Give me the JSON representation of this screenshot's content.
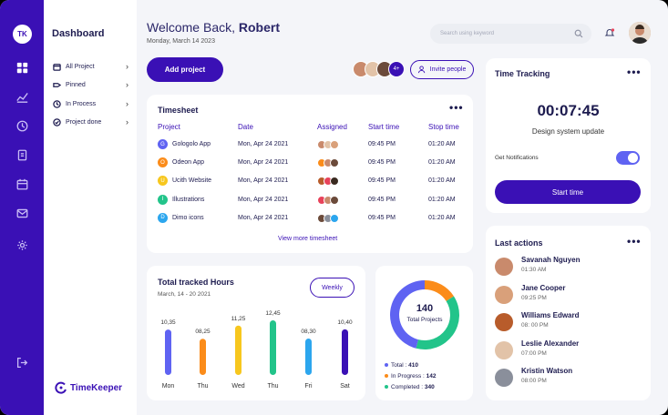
{
  "rail": {
    "logo": "TK"
  },
  "sidebar": {
    "title": "Dashboard",
    "items": [
      {
        "label": "All Project"
      },
      {
        "label": "Pinned"
      },
      {
        "label": "In Process"
      },
      {
        "label": "Project done"
      }
    ],
    "brand": "TimeKeeper"
  },
  "header": {
    "welcome_prefix": "Welcome Back, ",
    "user": "Robert",
    "date": "Monday, March 14 2023",
    "search_placeholder": "Search using keyword"
  },
  "actions": {
    "add_project": "Add project",
    "more_count": "4+",
    "invite": "Invite people"
  },
  "timesheet": {
    "title": "Timesheet",
    "columns": [
      "Project",
      "Date",
      "Assigned",
      "Start time",
      "Stop time"
    ],
    "rows": [
      {
        "icon": "G",
        "color": "#5f63f2",
        "project": "Gologolo App",
        "date": "Mon, Apr 24 2021",
        "start": "09:45 PM",
        "stop": "01:20 AM"
      },
      {
        "icon": "O",
        "color": "#fb8c1a",
        "project": "Odeon App",
        "date": "Mon, Apr 24 2021",
        "start": "09:45 PM",
        "stop": "01:20 AM"
      },
      {
        "icon": "U",
        "color": "#f7c71e",
        "project": "Ucith Website",
        "date": "Mon, Apr 24 2021",
        "start": "09:45 PM",
        "stop": "01:20 AM"
      },
      {
        "icon": "I",
        "color": "#22c48a",
        "project": "Illustrations",
        "date": "Mon, Apr 24 2021",
        "start": "09:45 PM",
        "stop": "01:20 AM"
      },
      {
        "icon": "D",
        "color": "#2ca6ee",
        "project": "Dimo icons",
        "date": "Mon, Apr 24 2021",
        "start": "09:45 PM",
        "stop": "01:20 AM"
      }
    ],
    "view_more": "View more timesheet"
  },
  "tracked": {
    "title": "Total tracked Hours",
    "range": "March, 14 - 20 2021",
    "weekly": "Weekly"
  },
  "chart_data": {
    "type": "bar",
    "categories": [
      "Mon",
      "Thu",
      "Wed",
      "Thu",
      "Fri",
      "Sat"
    ],
    "values": [
      10.35,
      8.25,
      11.25,
      12.45,
      8.3,
      10.4
    ],
    "value_labels": [
      "10,35",
      "08,25",
      "11,25",
      "12,45",
      "08,30",
      "10,40"
    ],
    "colors": [
      "#5f63f2",
      "#fb8c1a",
      "#f7c71e",
      "#22c48a",
      "#2ca6ee",
      "#3a10b5"
    ],
    "title": "Total tracked Hours",
    "grid": false
  },
  "projects_donut": {
    "total_value": "140",
    "total_label": "Total Projects",
    "slices": [
      {
        "value": 142,
        "color": "#fb8c1a"
      },
      {
        "value": 340,
        "color": "#22c48a"
      },
      {
        "value": 410,
        "color": "#5f63f2"
      }
    ],
    "legend": [
      {
        "text": "Total : ",
        "value": "410",
        "color": "#5f63f2"
      },
      {
        "text": "In Progress : ",
        "value": "142",
        "color": "#fb8c1a"
      },
      {
        "text": "Completed : ",
        "value": "340",
        "color": "#22c48a"
      }
    ]
  },
  "time_tracking": {
    "title": "Time Tracking",
    "time": "00:07:45",
    "task": "Design system update",
    "notifications_label": "Get Notifications",
    "notifications_on": true,
    "start_label": "Start time"
  },
  "last_actions": {
    "title": "Last actions",
    "items": [
      {
        "name": "Savanah Nguyen",
        "time": "01:30 AM",
        "color": "#c98a6c"
      },
      {
        "name": "Jane Cooper",
        "time": "09:25 PM",
        "color": "#d9a07a"
      },
      {
        "name": "Williams Edward",
        "time": "08: 00 PM",
        "color": "#b85c2b"
      },
      {
        "name": "Leslie Alexander",
        "time": "07:00 PM",
        "color": "#e2c3a8"
      },
      {
        "name": "Kristin Watson",
        "time": "08:00 PM",
        "color": "#8a8f9b"
      }
    ]
  }
}
